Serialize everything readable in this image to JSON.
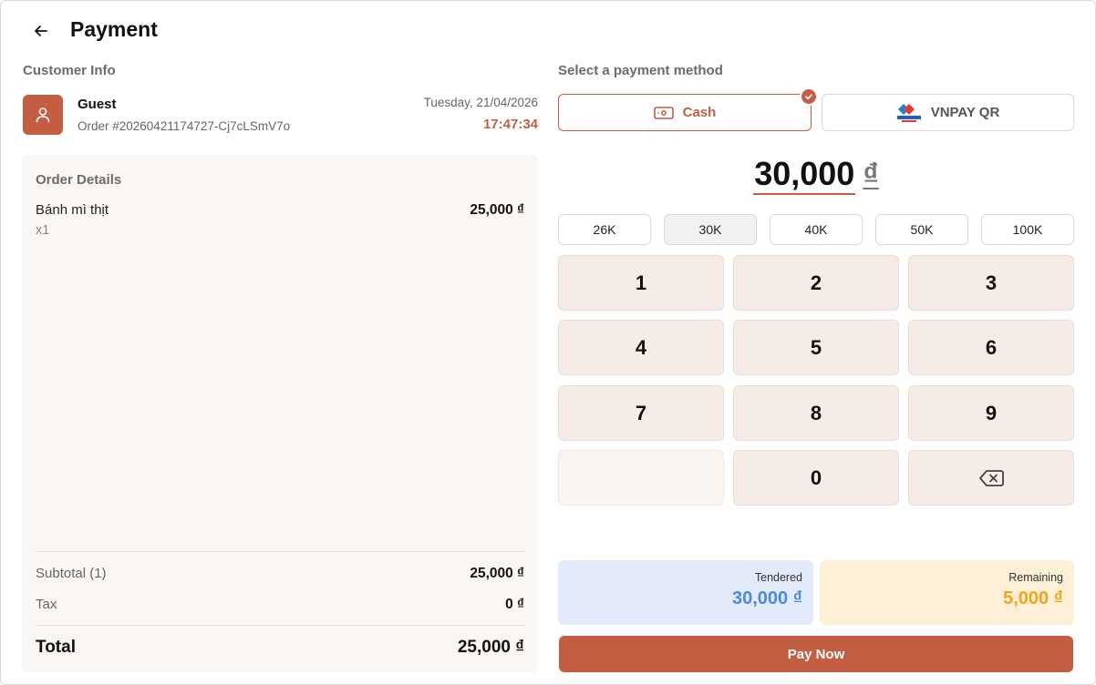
{
  "header": {
    "title": "Payment"
  },
  "customer": {
    "section_label": "Customer Info",
    "name": "Guest",
    "order_number": "Order #20260421174727-Cj7cLSmV7o",
    "date": "Tuesday, 21/04/2026",
    "time": "17:47:34"
  },
  "order": {
    "section_label": "Order Details",
    "items": [
      {
        "name": "Bánh mì thịt",
        "qty": "x1",
        "price": "25,000 ₫"
      }
    ],
    "subtotal_label": "Subtotal (1)",
    "subtotal_value": "25,000 ₫",
    "tax_label": "Tax",
    "tax_value": "0 ₫",
    "total_label": "Total",
    "total_value": "25,000 ₫"
  },
  "payment": {
    "section_label": "Select a payment method",
    "methods": [
      {
        "label": "Cash",
        "selected": true,
        "icon": "banknote-icon"
      },
      {
        "label": "VNPAY QR",
        "selected": false,
        "icon": "vnpay-logo"
      }
    ],
    "amount": "30,000",
    "currency": "₫",
    "quick_amounts": [
      {
        "label": "26K",
        "active": false
      },
      {
        "label": "30K",
        "active": true
      },
      {
        "label": "40K",
        "active": false
      },
      {
        "label": "50K",
        "active": false
      },
      {
        "label": "100K",
        "active": false
      }
    ],
    "keypad": [
      "1",
      "2",
      "3",
      "4",
      "5",
      "6",
      "7",
      "8",
      "9",
      "",
      "0",
      "backspace"
    ],
    "tendered_label": "Tendered",
    "tendered_value": "30,000 ₫",
    "remaining_label": "Remaining",
    "remaining_value": "5,000 ₫",
    "pay_button": "Pay Now"
  },
  "colors": {
    "accent": "#c45e42",
    "tendered": "#4a8ae0",
    "remaining": "#f0a61c"
  }
}
